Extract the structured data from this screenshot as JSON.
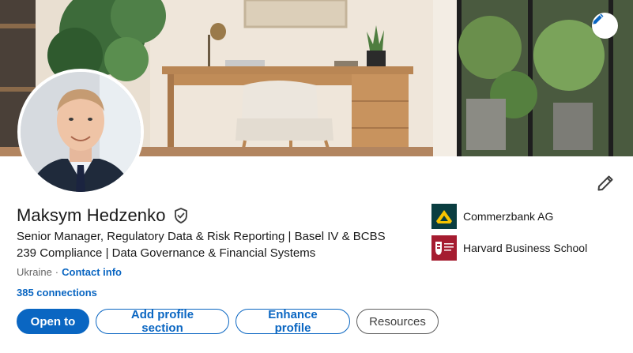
{
  "banner": {
    "edit_icon": "pencil-icon"
  },
  "profile": {
    "name": "Maksym Hedzenko",
    "verified_icon": "verified-shield-icon",
    "headline_line1": "Senior Manager, Regulatory Data & Risk Reporting | Basel IV & BCBS",
    "headline_line2": "239 Compliance | Data Governance & Financial Systems",
    "location": "Ukraine",
    "separator": "·",
    "contact_info": "Contact info",
    "connections": "385 connections",
    "edit_icon": "pencil-icon"
  },
  "actions": {
    "open_to": "Open to",
    "add_profile_section": "Add profile section",
    "enhance_profile": "Enhance profile",
    "resources": "Resources"
  },
  "organizations": [
    {
      "name": "Commerzbank AG",
      "logo_icon": "commerzbank-logo"
    },
    {
      "name": "Harvard Business School",
      "logo_icon": "harvard-logo"
    }
  ],
  "colors": {
    "accent": "#0a66c2",
    "text": "#191919",
    "muted": "#666666",
    "commerzbank_bg": "#0a3d40",
    "commerzbank_yellow": "#f7c300",
    "harvard_red": "#a51c30"
  }
}
